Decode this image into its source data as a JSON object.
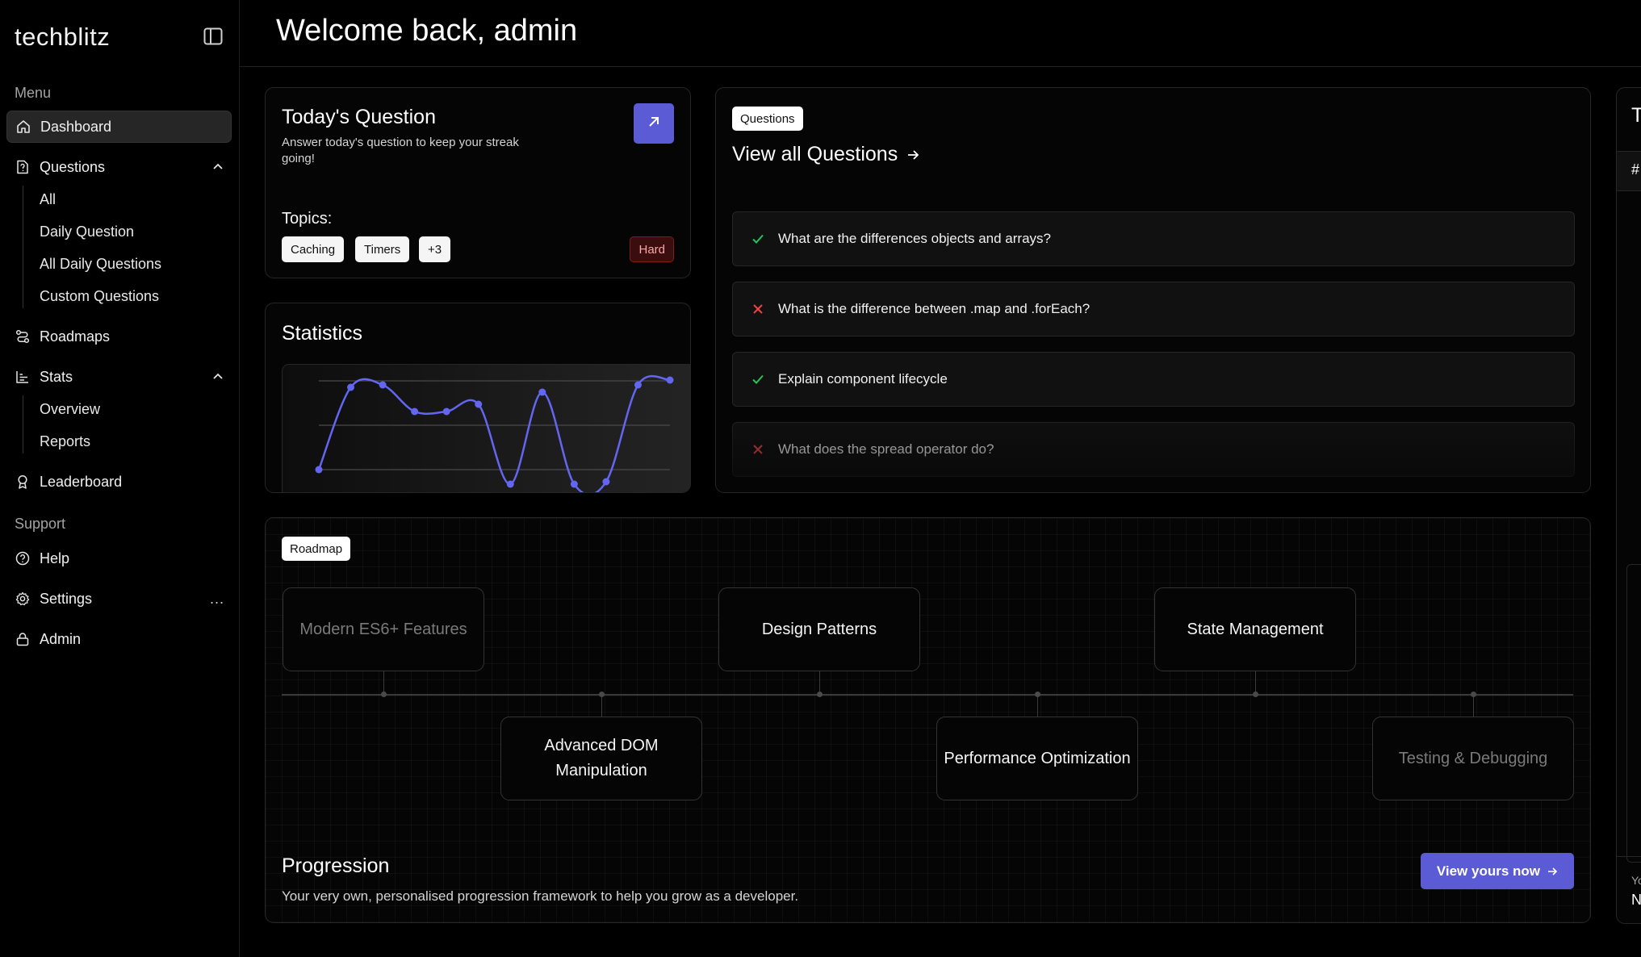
{
  "app": {
    "logo": "techblitz"
  },
  "sidebar": {
    "menu_label": "Menu",
    "support_label": "Support",
    "items": {
      "dashboard": "Dashboard",
      "questions": "Questions",
      "roadmaps": "Roadmaps",
      "stats": "Stats",
      "leaderboard": "Leaderboard",
      "help": "Help",
      "settings": "Settings",
      "admin": "Admin"
    },
    "questions_sub": [
      "All",
      "Daily Question",
      "All Daily Questions",
      "Custom Questions"
    ],
    "stats_sub": [
      "Overview",
      "Reports"
    ],
    "settings_more": "..."
  },
  "header": {
    "title": "Welcome back, admin"
  },
  "todays_question": {
    "title": "Today's Question",
    "description": "Answer today's question to keep your streak going!",
    "topics_label": "Topics:",
    "topics": [
      "Caching",
      "Timers",
      "+3"
    ],
    "difficulty": "Hard"
  },
  "statistics": {
    "title": "Statistics"
  },
  "chart_data": {
    "type": "line",
    "title": "Statistics",
    "series": [
      {
        "values": [
          0,
          3.4,
          3.5,
          2.4,
          2.4,
          2.7,
          -0.6,
          3.2,
          -0.6,
          -0.5,
          3.5,
          3.7
        ]
      }
    ],
    "grid": true,
    "color": "#6366f1"
  },
  "questions_card": {
    "tag": "Questions",
    "title": "View all Questions",
    "items": [
      {
        "text": "What are the differences objects and arrays?",
        "status": "correct"
      },
      {
        "text": "What is the difference between .map and .forEach?",
        "status": "incorrect"
      },
      {
        "text": "Explain component lifecycle",
        "status": "correct"
      },
      {
        "text": "What does the spread operator do?",
        "status": "incorrect"
      }
    ]
  },
  "roadmap": {
    "tag": "Roadmap",
    "nodes_top": [
      "Modern ES6+ Features",
      "Design Patterns",
      "State Management"
    ],
    "nodes_bottom": [
      "Advanced DOM Manipulation",
      "Performance Optimization",
      "Testing & Debugging"
    ],
    "progression_title": "Progression",
    "progression_desc": "Your very own, personalised progression framework to help you grow as a developer.",
    "cta": "View yours now"
  },
  "right_card": {
    "title_fragment": "T",
    "header_fragment": "#",
    "footer_fragment_1": "Yo",
    "footer_fragment_2": "N"
  },
  "colors": {
    "accent": "#5b5bd6",
    "correct": "#22c55e",
    "incorrect": "#ef4444",
    "danger_bg": "#3a0e0e"
  }
}
